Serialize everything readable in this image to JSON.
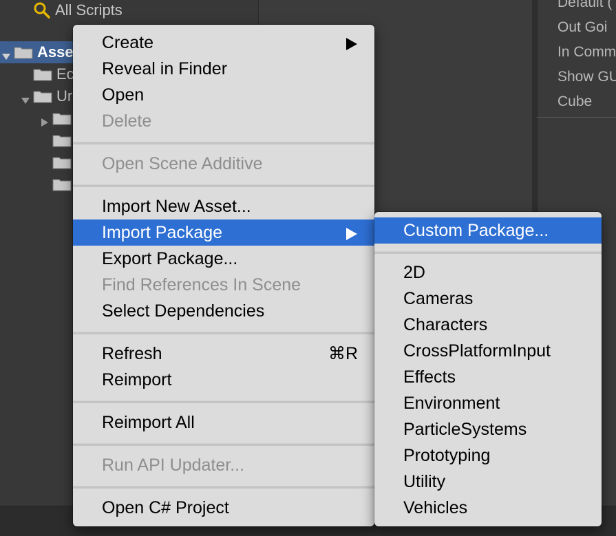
{
  "background": {
    "all_scripts_label": "All Scripts",
    "tree": [
      {
        "label": "Asse",
        "selected": true
      },
      {
        "label": "Ec"
      },
      {
        "label": "Ur"
      },
      {
        "label": ""
      },
      {
        "label": ""
      },
      {
        "label": ""
      },
      {
        "label": ""
      }
    ],
    "right_items": [
      "Default (",
      "Out Goi",
      "In Comm",
      "Show GU",
      "Cube"
    ]
  },
  "main_menu": {
    "create": "Create",
    "reveal_in_finder": "Reveal in Finder",
    "open": "Open",
    "delete": "Delete",
    "open_scene_additive": "Open Scene Additive",
    "import_new_asset": "Import New Asset...",
    "import_package": "Import Package",
    "export_package": "Export Package...",
    "find_references_in_scene": "Find References In Scene",
    "select_dependencies": "Select Dependencies",
    "refresh": "Refresh",
    "refresh_shortcut": "⌘R",
    "reimport": "Reimport",
    "reimport_all": "Reimport All",
    "run_api_updater": "Run API Updater...",
    "open_csharp_project": "Open C# Project"
  },
  "sub_menu": {
    "custom_package": "Custom Package...",
    "items": [
      "2D",
      "Cameras",
      "Characters",
      "CrossPlatformInput",
      "Effects",
      "Environment",
      "ParticleSystems",
      "Prototyping",
      "Utility",
      "Vehicles"
    ]
  },
  "colors": {
    "highlight": "#2e6fd4",
    "menu_bg": "#dcdcdc",
    "disabled_text": "#8e8e8e",
    "tree_selected": "#3d5f91"
  }
}
